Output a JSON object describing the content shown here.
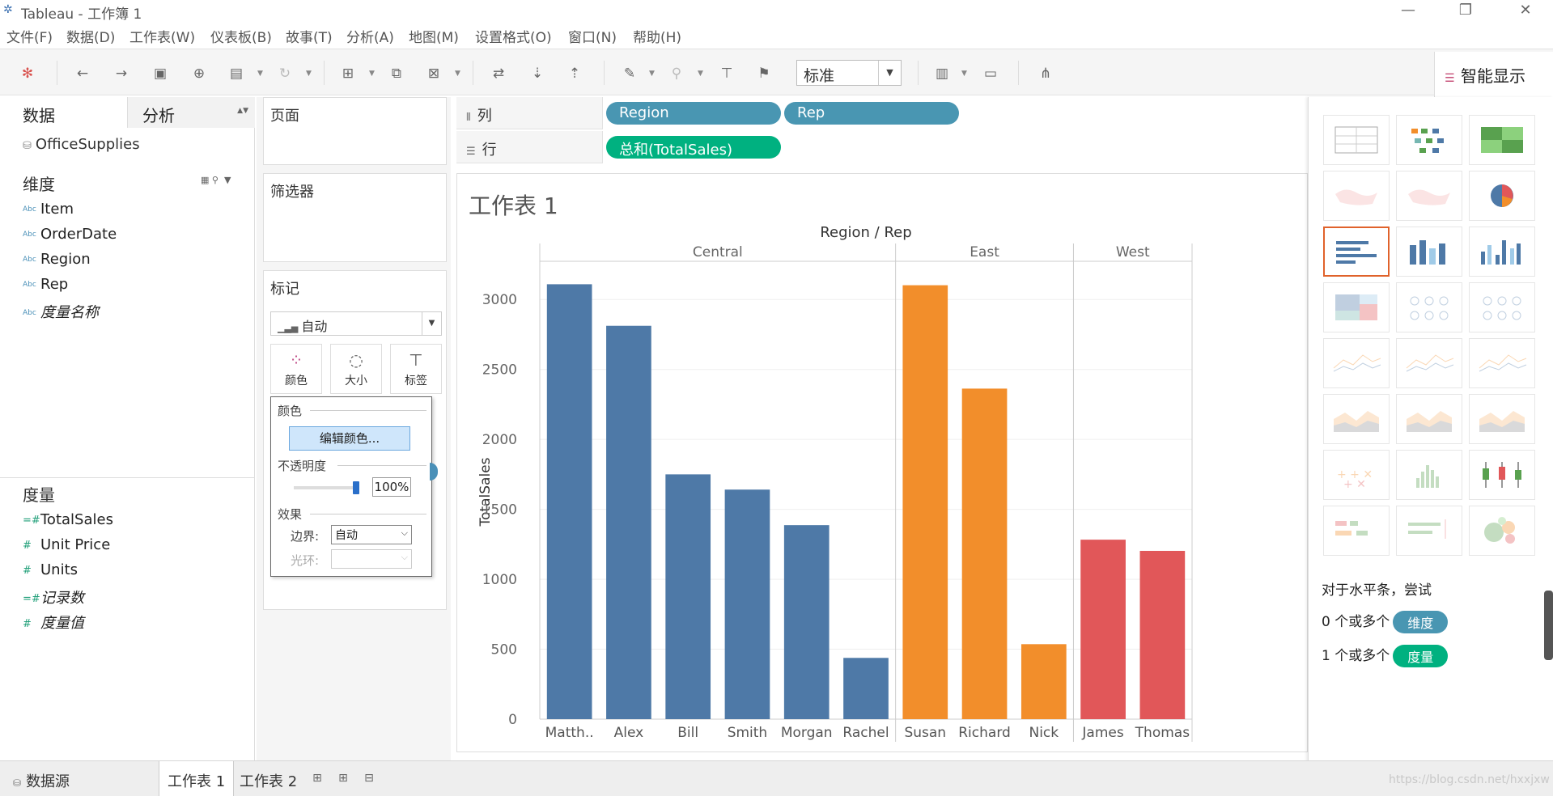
{
  "window": {
    "title": "Tableau - 工作簿 1",
    "controls": [
      "—",
      "❐",
      "✕"
    ]
  },
  "menu": [
    "文件(F)",
    "数据(D)",
    "工作表(W)",
    "仪表板(B)",
    "故事(T)",
    "分析(A)",
    "地图(M)",
    "设置格式(O)",
    "窗口(N)",
    "帮助(H)"
  ],
  "toolbar": {
    "fit_mode": "标准",
    "icons": [
      "tableau-logo-icon",
      "undo-icon",
      "redo-icon",
      "save-icon",
      "new-datasource-icon",
      "pause-icon",
      "refresh-icon",
      "new-sheet-icon",
      "duplicate-icon",
      "clear-icon",
      "swap-icon",
      "sort-asc-icon",
      "sort-desc-icon",
      "highlight-icon",
      "group-icon",
      "label-icon",
      "pin-icon",
      "show-cards-icon",
      "presentation-icon",
      "share-icon"
    ]
  },
  "show_me_tab": {
    "label": "智能显示"
  },
  "data_pane": {
    "tab_data": "数据",
    "tab_analysis": "分析",
    "datasource": "OfficeSupplies",
    "dimensions_title": "维度",
    "dimensions": [
      {
        "label": "Item",
        "type": "Abc",
        "italic": false
      },
      {
        "label": "OrderDate",
        "type": "Abc",
        "italic": false
      },
      {
        "label": "Region",
        "type": "Abc",
        "italic": false
      },
      {
        "label": "Rep",
        "type": "Abc",
        "italic": false
      },
      {
        "label": "度量名称",
        "type": "Abc",
        "italic": true
      }
    ],
    "measures_title": "度量",
    "measures": [
      {
        "label": "TotalSales",
        "type": "=#",
        "italic": false
      },
      {
        "label": "Unit Price",
        "type": "#",
        "italic": false
      },
      {
        "label": "Units",
        "type": "#",
        "italic": false
      },
      {
        "label": "记录数",
        "type": "=#",
        "italic": true
      },
      {
        "label": "度量值",
        "type": "#",
        "italic": true
      }
    ]
  },
  "cards": {
    "pages": "页面",
    "filters": "筛选器",
    "marks": "标记",
    "mark_type": "自动",
    "mark_buttons": [
      "颜色",
      "大小",
      "标签"
    ]
  },
  "color_popup": {
    "color_title": "颜色",
    "edit_button": "编辑颜色...",
    "opacity_title": "不透明度",
    "opacity_value": "100%",
    "opacity_fraction": 1.0,
    "effects_title": "效果",
    "border_label": "边界:",
    "border_value": "自动",
    "halo_label": "光环:",
    "halo_value": ""
  },
  "shelves": {
    "columns_label": "列",
    "rows_label": "行",
    "column_pills": [
      "Region",
      "Rep"
    ],
    "row_pills": [
      "总和(TotalSales)"
    ]
  },
  "sheet": {
    "title": "工作表 1"
  },
  "chart_data": {
    "type": "bar",
    "title": "Region / Rep",
    "ylabel": "TotalSales",
    "ylim": [
      0,
      3250
    ],
    "yticks": [
      0,
      500,
      1000,
      1500,
      2000,
      2500,
      3000
    ],
    "grid": true,
    "groups": [
      {
        "name": "Central",
        "color": "#4e79a7",
        "categories": [
          "Matth..",
          "Alex",
          "Bill",
          "Smith",
          "Morgan",
          "Rachel"
        ],
        "values": [
          3109,
          2812,
          1750,
          1641,
          1387,
          438
        ]
      },
      {
        "name": "East",
        "color": "#f28e2b",
        "categories": [
          "Susan",
          "Richard",
          "Nick"
        ],
        "values": [
          3102,
          2363,
          536
        ]
      },
      {
        "name": "West",
        "color": "#e15759",
        "categories": [
          "James",
          "Thomas"
        ],
        "values": [
          1283,
          1203
        ]
      }
    ]
  },
  "show_me": {
    "hint": "对于水平条，尝试",
    "req_dim_text": "0 个或多个",
    "req_dim_pill": "维度",
    "req_meas_text": "1 个或多个",
    "req_meas_pill": "度量",
    "selected_index": 6
  },
  "bottom_tabs": {
    "datasource": "数据源",
    "sheets": [
      "工作表 1",
      "工作表 2"
    ],
    "active": 0
  },
  "watermark": "https://blog.csdn.net/hxxjxw"
}
